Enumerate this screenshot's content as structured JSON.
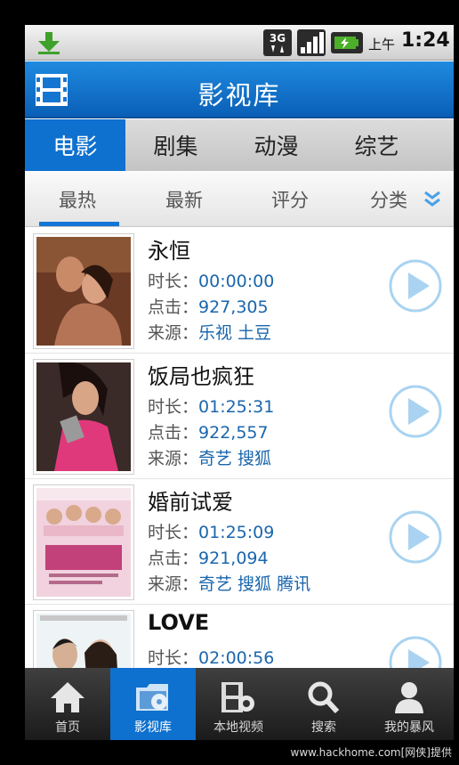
{
  "status_bar": {
    "network": "3G",
    "am_pm": "上午",
    "time": "1:24"
  },
  "header": {
    "title": "影视库"
  },
  "category_tabs": [
    {
      "label": "电影",
      "active": true
    },
    {
      "label": "剧集",
      "active": false
    },
    {
      "label": "动漫",
      "active": false
    },
    {
      "label": "综艺",
      "active": false
    }
  ],
  "sort_tabs": [
    {
      "label": "最热",
      "active": true
    },
    {
      "label": "最新",
      "active": false
    },
    {
      "label": "评分",
      "active": false
    },
    {
      "label": "分类",
      "active": false
    }
  ],
  "labels": {
    "duration": "时长：",
    "clicks": "点击：",
    "source": "来源："
  },
  "movies": [
    {
      "title": "永恒",
      "duration": "00:00:00",
      "clicks": "927,305",
      "sources": "乐视 土豆"
    },
    {
      "title": "饭局也疯狂",
      "duration": "01:25:31",
      "clicks": "922,557",
      "sources": "奇艺 搜狐"
    },
    {
      "title": "婚前试爱",
      "duration": "01:25:09",
      "clicks": "921,094",
      "sources": "奇艺 搜狐 腾讯"
    },
    {
      "title": "LOVE",
      "duration": "02:00:56",
      "clicks": "",
      "sources": ""
    }
  ],
  "bottom_nav": [
    {
      "label": "首页",
      "icon": "home-icon",
      "active": false
    },
    {
      "label": "影视库",
      "icon": "film-folder-icon",
      "active": true
    },
    {
      "label": "本地视频",
      "icon": "film-gear-icon",
      "active": false
    },
    {
      "label": "搜索",
      "icon": "search-icon",
      "active": false
    },
    {
      "label": "我的暴风",
      "icon": "user-icon",
      "active": false
    }
  ],
  "watermark": "www.hackhome.com[网侠]提供",
  "colors": {
    "accent": "#0e70cf",
    "link": "#1a66ad",
    "play_button": "#a9d3f1"
  }
}
